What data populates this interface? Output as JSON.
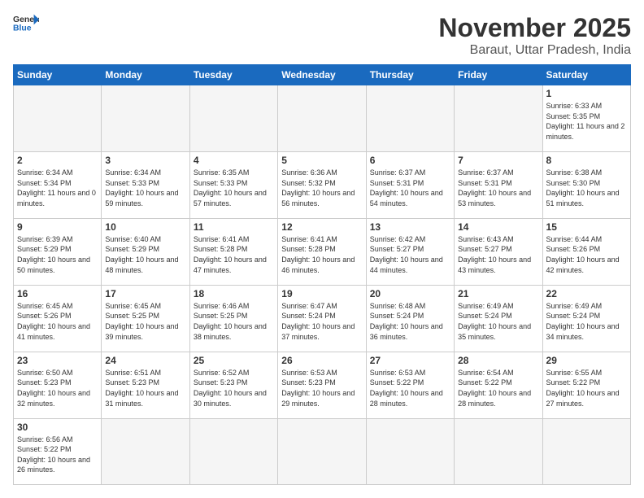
{
  "header": {
    "logo_general": "General",
    "logo_blue": "Blue",
    "month_title": "November 2025",
    "subtitle": "Baraut, Uttar Pradesh, India"
  },
  "weekdays": [
    "Sunday",
    "Monday",
    "Tuesday",
    "Wednesday",
    "Thursday",
    "Friday",
    "Saturday"
  ],
  "weeks": [
    [
      {
        "day": "",
        "empty": true
      },
      {
        "day": "",
        "empty": true
      },
      {
        "day": "",
        "empty": true
      },
      {
        "day": "",
        "empty": true
      },
      {
        "day": "",
        "empty": true
      },
      {
        "day": "",
        "empty": true
      },
      {
        "day": "1",
        "sunrise": "6:33 AM",
        "sunset": "5:35 PM",
        "daylight": "11 hours and 2 minutes."
      }
    ],
    [
      {
        "day": "2",
        "sunrise": "6:34 AM",
        "sunset": "5:34 PM",
        "daylight": "11 hours and 0 minutes."
      },
      {
        "day": "3",
        "sunrise": "6:34 AM",
        "sunset": "5:33 PM",
        "daylight": "10 hours and 59 minutes."
      },
      {
        "day": "4",
        "sunrise": "6:35 AM",
        "sunset": "5:33 PM",
        "daylight": "10 hours and 57 minutes."
      },
      {
        "day": "5",
        "sunrise": "6:36 AM",
        "sunset": "5:32 PM",
        "daylight": "10 hours and 56 minutes."
      },
      {
        "day": "6",
        "sunrise": "6:37 AM",
        "sunset": "5:31 PM",
        "daylight": "10 hours and 54 minutes."
      },
      {
        "day": "7",
        "sunrise": "6:37 AM",
        "sunset": "5:31 PM",
        "daylight": "10 hours and 53 minutes."
      },
      {
        "day": "8",
        "sunrise": "6:38 AM",
        "sunset": "5:30 PM",
        "daylight": "10 hours and 51 minutes."
      }
    ],
    [
      {
        "day": "9",
        "sunrise": "6:39 AM",
        "sunset": "5:29 PM",
        "daylight": "10 hours and 50 minutes."
      },
      {
        "day": "10",
        "sunrise": "6:40 AM",
        "sunset": "5:29 PM",
        "daylight": "10 hours and 48 minutes."
      },
      {
        "day": "11",
        "sunrise": "6:41 AM",
        "sunset": "5:28 PM",
        "daylight": "10 hours and 47 minutes."
      },
      {
        "day": "12",
        "sunrise": "6:41 AM",
        "sunset": "5:28 PM",
        "daylight": "10 hours and 46 minutes."
      },
      {
        "day": "13",
        "sunrise": "6:42 AM",
        "sunset": "5:27 PM",
        "daylight": "10 hours and 44 minutes."
      },
      {
        "day": "14",
        "sunrise": "6:43 AM",
        "sunset": "5:27 PM",
        "daylight": "10 hours and 43 minutes."
      },
      {
        "day": "15",
        "sunrise": "6:44 AM",
        "sunset": "5:26 PM",
        "daylight": "10 hours and 42 minutes."
      }
    ],
    [
      {
        "day": "16",
        "sunrise": "6:45 AM",
        "sunset": "5:26 PM",
        "daylight": "10 hours and 41 minutes."
      },
      {
        "day": "17",
        "sunrise": "6:45 AM",
        "sunset": "5:25 PM",
        "daylight": "10 hours and 39 minutes."
      },
      {
        "day": "18",
        "sunrise": "6:46 AM",
        "sunset": "5:25 PM",
        "daylight": "10 hours and 38 minutes."
      },
      {
        "day": "19",
        "sunrise": "6:47 AM",
        "sunset": "5:24 PM",
        "daylight": "10 hours and 37 minutes."
      },
      {
        "day": "20",
        "sunrise": "6:48 AM",
        "sunset": "5:24 PM",
        "daylight": "10 hours and 36 minutes."
      },
      {
        "day": "21",
        "sunrise": "6:49 AM",
        "sunset": "5:24 PM",
        "daylight": "10 hours and 35 minutes."
      },
      {
        "day": "22",
        "sunrise": "6:49 AM",
        "sunset": "5:24 PM",
        "daylight": "10 hours and 34 minutes."
      }
    ],
    [
      {
        "day": "23",
        "sunrise": "6:50 AM",
        "sunset": "5:23 PM",
        "daylight": "10 hours and 32 minutes."
      },
      {
        "day": "24",
        "sunrise": "6:51 AM",
        "sunset": "5:23 PM",
        "daylight": "10 hours and 31 minutes."
      },
      {
        "day": "25",
        "sunrise": "6:52 AM",
        "sunset": "5:23 PM",
        "daylight": "10 hours and 30 minutes."
      },
      {
        "day": "26",
        "sunrise": "6:53 AM",
        "sunset": "5:23 PM",
        "daylight": "10 hours and 29 minutes."
      },
      {
        "day": "27",
        "sunrise": "6:53 AM",
        "sunset": "5:22 PM",
        "daylight": "10 hours and 28 minutes."
      },
      {
        "day": "28",
        "sunrise": "6:54 AM",
        "sunset": "5:22 PM",
        "daylight": "10 hours and 28 minutes."
      },
      {
        "day": "29",
        "sunrise": "6:55 AM",
        "sunset": "5:22 PM",
        "daylight": "10 hours and 27 minutes."
      }
    ],
    [
      {
        "day": "30",
        "sunrise": "6:56 AM",
        "sunset": "5:22 PM",
        "daylight": "10 hours and 26 minutes."
      },
      {
        "day": "",
        "empty": true
      },
      {
        "day": "",
        "empty": true
      },
      {
        "day": "",
        "empty": true
      },
      {
        "day": "",
        "empty": true
      },
      {
        "day": "",
        "empty": true
      },
      {
        "day": "",
        "empty": true
      }
    ]
  ]
}
